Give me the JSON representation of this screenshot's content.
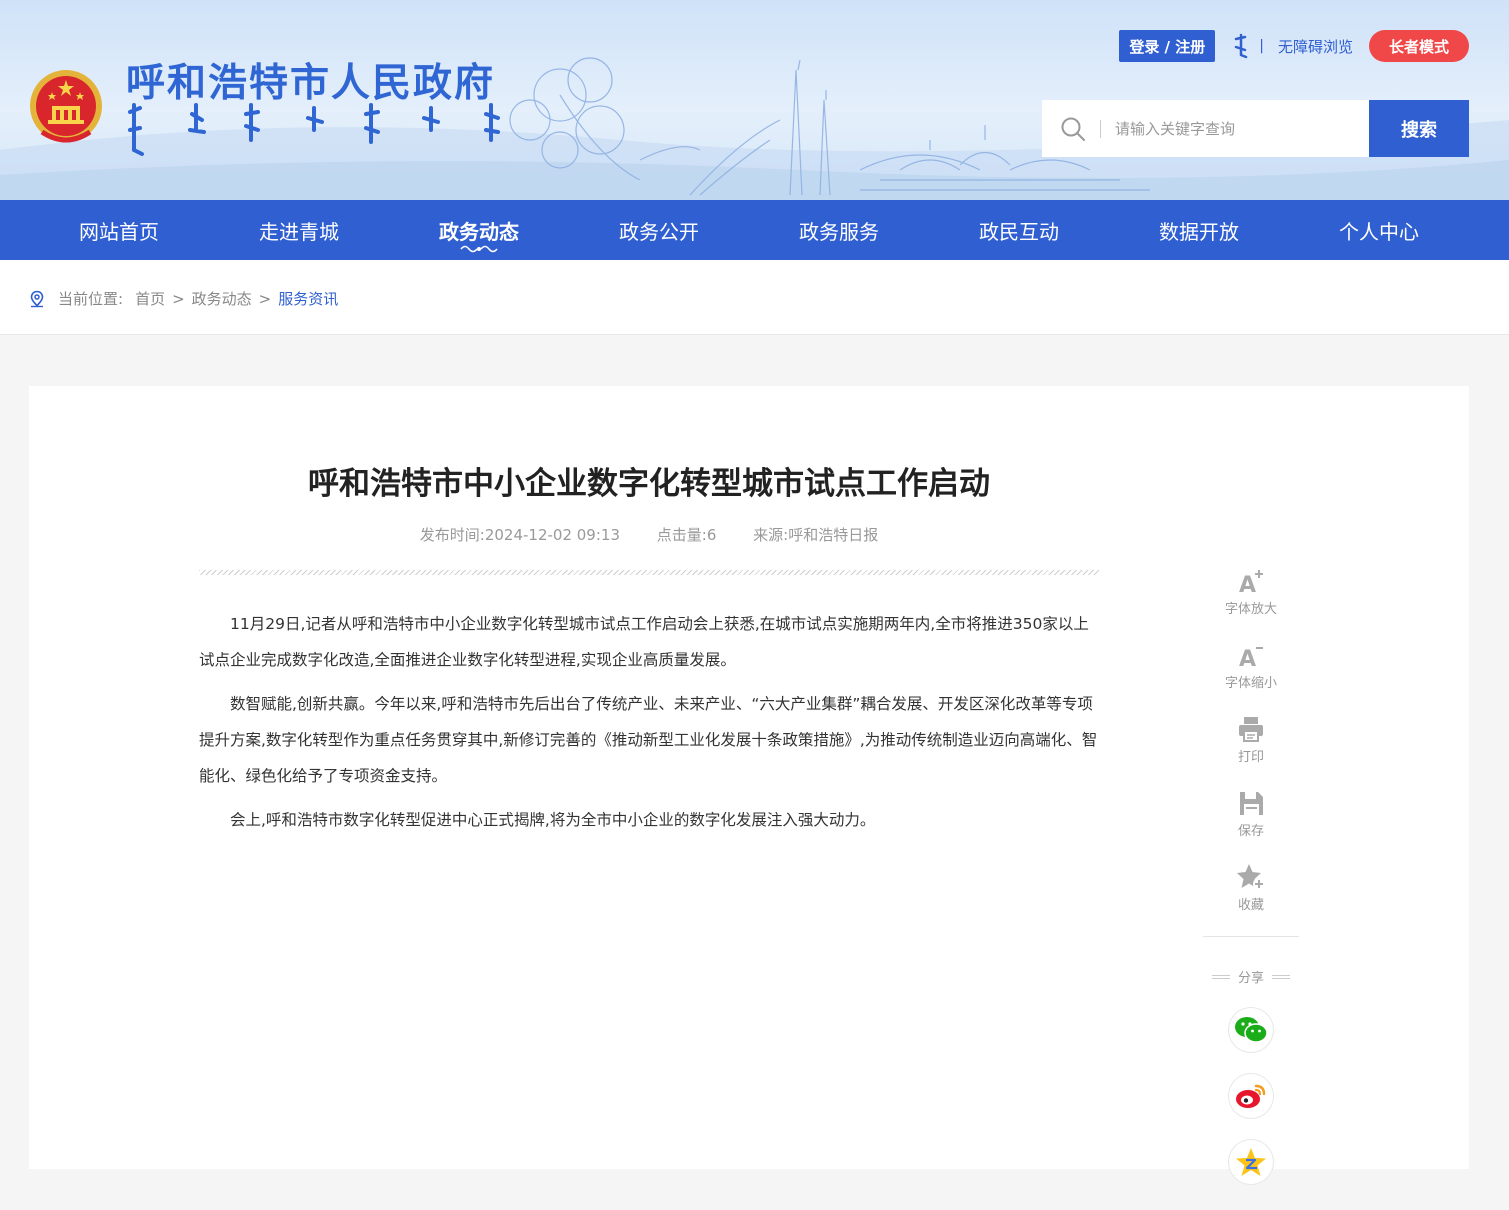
{
  "header": {
    "site_title": "呼和浩特市人民政府",
    "login_label": "登录 / 注册",
    "separator": "|",
    "accessible_label": "无障碍浏览",
    "elder_mode_label": "长者模式",
    "search": {
      "placeholder": "请输入关键字查询",
      "button_label": "搜索"
    }
  },
  "nav": {
    "items": [
      {
        "label": "网站首页"
      },
      {
        "label": "走进青城"
      },
      {
        "label": "政务动态",
        "active": true
      },
      {
        "label": "政务公开"
      },
      {
        "label": "政务服务"
      },
      {
        "label": "政民互动"
      },
      {
        "label": "数据开放"
      },
      {
        "label": "个人中心"
      }
    ]
  },
  "breadcrumb": {
    "label": "当前位置:",
    "items": [
      "首页",
      "政务动态"
    ],
    "separator": ">",
    "current": "服务资讯"
  },
  "article": {
    "title": "呼和浩特市中小企业数字化转型城市试点工作启动",
    "publish_time": "发布时间:2024-12-02 09:13",
    "clicks": "点击量:6",
    "source": "来源:呼和浩特日报",
    "paragraphs": [
      "11月29日,记者从呼和浩特市中小企业数字化转型城市试点工作启动会上获悉,在城市试点实施期两年内,全市将推进350家以上试点企业完成数字化改造,全面推进企业数字化转型进程,实现企业高质量发展。",
      "数智赋能,创新共赢。今年以来,呼和浩特市先后出台了传统产业、未来产业、“六大产业集群”耦合发展、开发区深化改革等专项提升方案,数字化转型作为重点任务贯穿其中,新修订完善的《推动新型工业化发展十条政策措施》,为推动传统制造业迈向高端化、智能化、绿色化给予了专项资金支持。",
      "会上,呼和浩特市数字化转型促进中心正式揭牌,将为全市中小企业的数字化发展注入强大动力。"
    ]
  },
  "tools": {
    "font_up": "字体放大",
    "font_down": "字体缩小",
    "print": "打印",
    "save": "保存",
    "favorite": "收藏",
    "share_title": "分享"
  },
  "colors": {
    "brand_blue": "#2f5fd0",
    "elder_red": "#f04848",
    "wechat_green": "#1aad19",
    "weibo_red": "#e6162d",
    "qzone_yellow": "#fcc419"
  }
}
